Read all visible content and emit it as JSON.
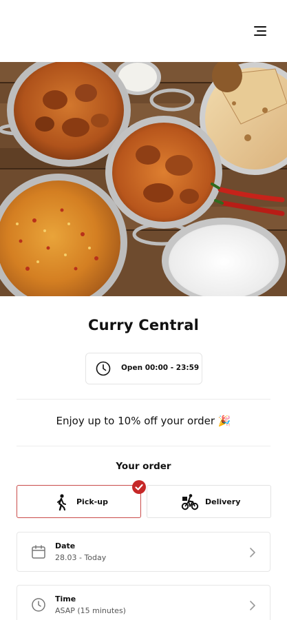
{
  "restaurant": {
    "name": "Curry Central"
  },
  "hours": {
    "text": "Open 00:00 - 23:59",
    "icon": "clock-icon"
  },
  "promo": {
    "text": "Enjoy up to 10% off your order 🎉"
  },
  "order": {
    "title": "Your order",
    "options": [
      {
        "label": "Pick-up",
        "icon": "walking-person-icon",
        "selected": true
      },
      {
        "label": "Delivery",
        "icon": "bicycle-icon",
        "selected": false
      }
    ],
    "date": {
      "label": "Date",
      "value": "28.03 - Today",
      "icon": "calendar-icon"
    },
    "time": {
      "label": "Time",
      "value": "ASAP (15 minutes)",
      "icon": "clock-icon"
    }
  },
  "colors": {
    "accent": "#c62828",
    "selected_border": "#c94a48",
    "border": "#e4e4e4",
    "text": "#111111"
  }
}
